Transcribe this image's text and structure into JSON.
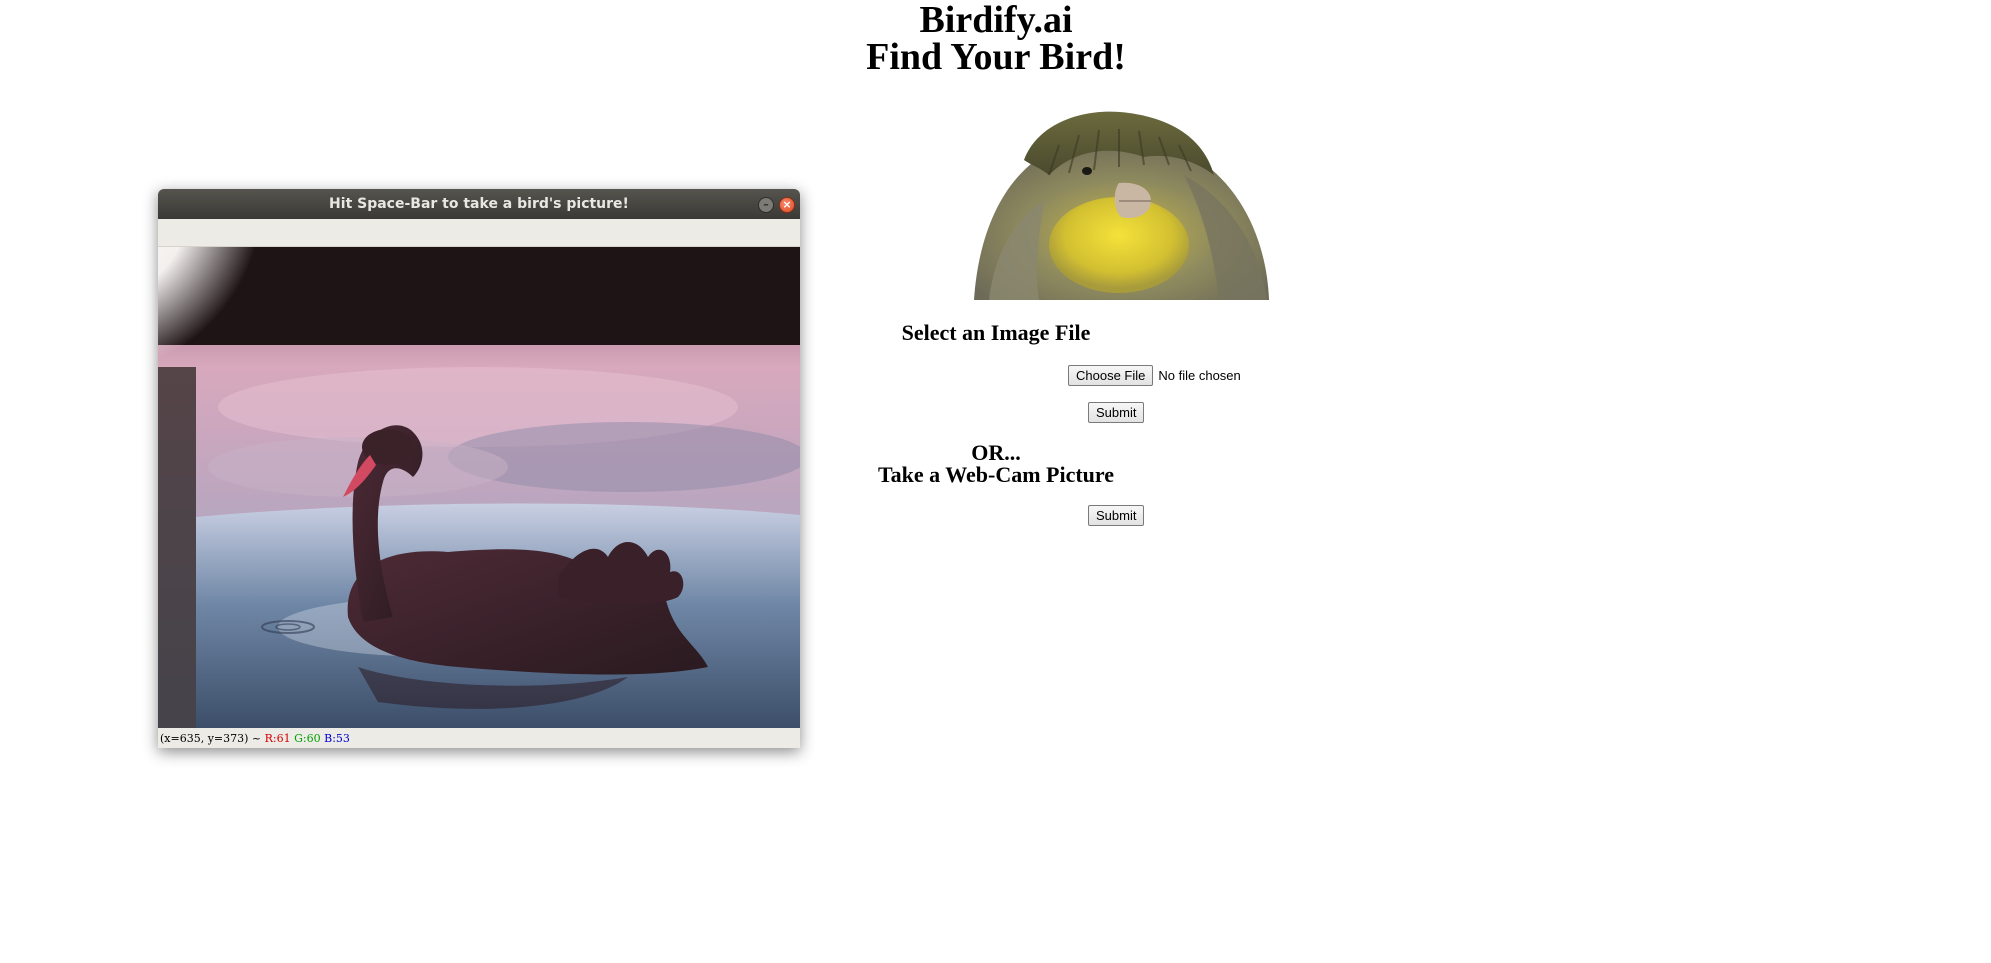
{
  "site": {
    "title": "Birdify.ai",
    "subtitle": "Find Your Bird!",
    "hero_icon": "canary-bird-photo"
  },
  "upload": {
    "heading": "Select an Image File",
    "choose_label": "Choose File",
    "file_status": "No file chosen",
    "submit_label": "Submit"
  },
  "webcam": {
    "or_text": "OR...",
    "heading": "Take a Web-Cam Picture",
    "submit_label": "Submit"
  },
  "camera_window": {
    "title": "Hit Space-Bar to take a bird's picture!",
    "preview_icon": "black-swan-camera-frame",
    "status": {
      "coords": "(x=635, y=373) ~",
      "r": "R:61",
      "g": "G:60",
      "b": "B:53"
    }
  }
}
